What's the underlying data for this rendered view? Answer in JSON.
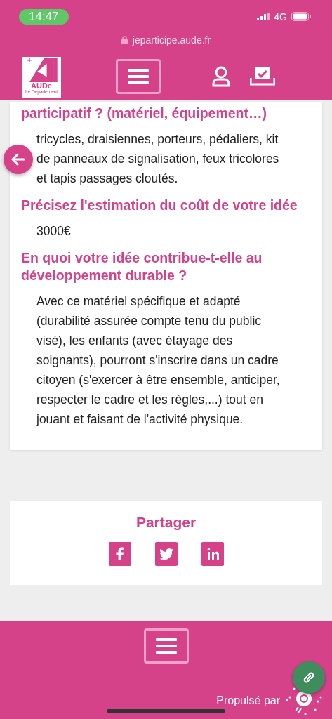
{
  "status_bar": {
    "time": "14:47",
    "network": "4G"
  },
  "url_bar": {
    "url": "jeparticipe.aude.fr"
  },
  "header": {
    "logo_text": "AUDe",
    "logo_subtext": "Le Département"
  },
  "content": [
    {
      "kind": "heading",
      "text": "participatif ? (matériel, équipement…)"
    },
    {
      "kind": "body",
      "text": "tricycles, draisiennes, porteurs, pédaliers, kit de panneaux de signalisation, feux tricolores et tapis passages cloutés."
    },
    {
      "kind": "heading",
      "text": "Précisez l'estimation du coût de votre idée"
    },
    {
      "kind": "body",
      "text": "3000€"
    },
    {
      "kind": "heading",
      "text": "En quoi votre idée contribue-t-elle au développement durable ?"
    },
    {
      "kind": "body",
      "text": "Avec ce matériel spécifique et adapté (durabilité assurée compte tenu du public visé), les enfants (avec étayage des soignants), pourront s'inscrire dans un cadre citoyen (s'exercer à être ensemble, anticiper, respecter le cadre et les règles,...) tout en jouant et faisant de l'activité physique."
    }
  ],
  "share": {
    "title": "Partager",
    "networks": [
      {
        "kind": "facebook"
      },
      {
        "kind": "twitter"
      },
      {
        "kind": "linkedin"
      }
    ]
  },
  "footer": {
    "powered_by": "Propulsé par"
  }
}
